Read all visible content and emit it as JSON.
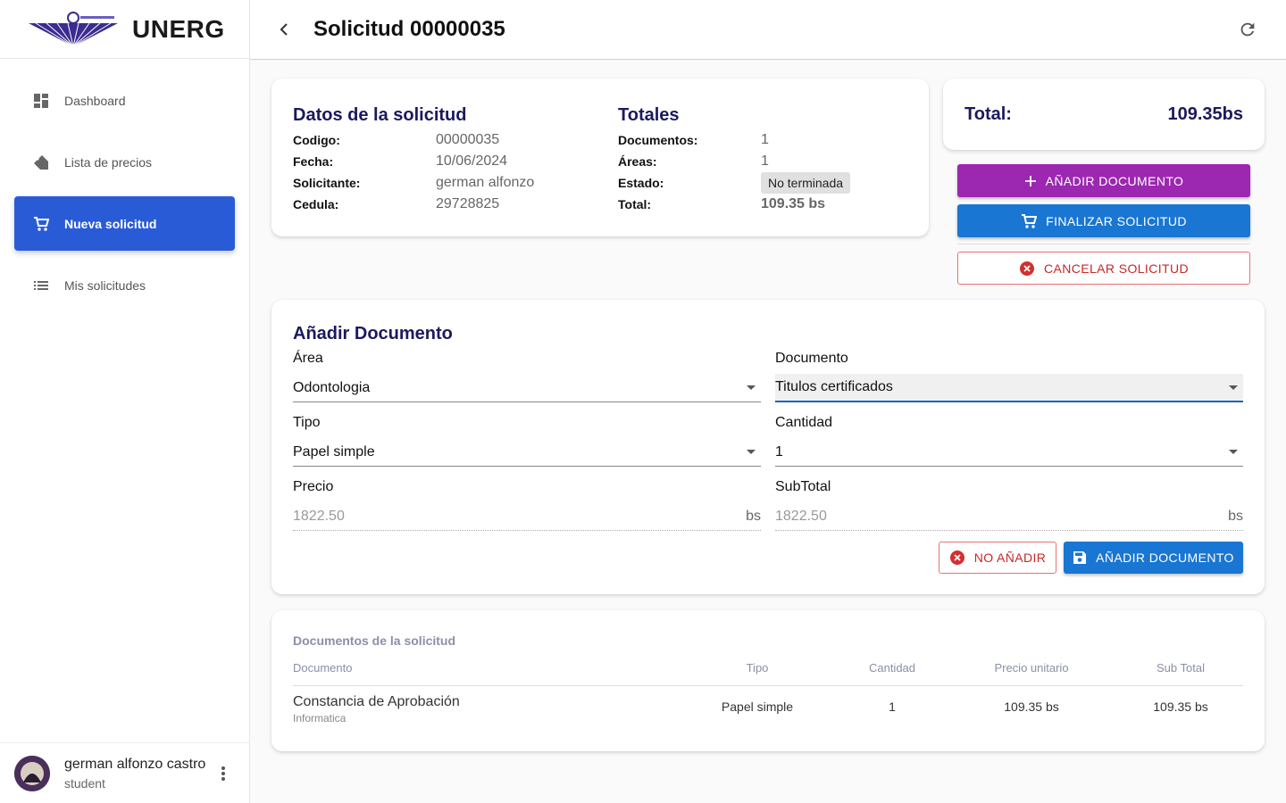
{
  "brand": {
    "name": "UNERG"
  },
  "sidebar": {
    "items": [
      {
        "label": "Dashboard",
        "icon": "dashboard-icon"
      },
      {
        "label": "Lista de precios",
        "icon": "tag-icon"
      },
      {
        "label": "Nueva solicitud",
        "icon": "cart-icon",
        "active": true
      },
      {
        "label": "Mis solicitudes",
        "icon": "list-icon"
      }
    ]
  },
  "user": {
    "name": "german alfonzo castro",
    "role": "student"
  },
  "header": {
    "title": "Solicitud 00000035"
  },
  "datos": {
    "title": "Datos de la solicitud",
    "rows": [
      {
        "label": "Codigo:",
        "value": "00000035"
      },
      {
        "label": "Fecha:",
        "value": "10/06/2024"
      },
      {
        "label": "Solicitante:",
        "value": "german alfonzo"
      },
      {
        "label": "Cedula:",
        "value": "29728825"
      }
    ]
  },
  "totales": {
    "title": "Totales",
    "rows": [
      {
        "label": "Documentos:",
        "value": "1"
      },
      {
        "label": "Áreas:",
        "value": "1"
      },
      {
        "label": "Estado:",
        "value": "No terminada"
      },
      {
        "label": "Total:",
        "value": "109.35 bs"
      }
    ]
  },
  "total_card": {
    "label": "Total:",
    "value": "109.35bs"
  },
  "actions": {
    "add_document": "AÑADIR DOCUMENTO",
    "finalize": "FINALIZAR SOLICITUD",
    "cancel": "CANCELAR SOLICITUD"
  },
  "add_form": {
    "title": "Añadir Documento",
    "area": {
      "label": "Área",
      "value": "Odontologia"
    },
    "documento": {
      "label": "Documento",
      "value": "Titulos certificados"
    },
    "tipo": {
      "label": "Tipo",
      "value": "Papel simple"
    },
    "cantidad": {
      "label": "Cantidad",
      "value": "1"
    },
    "precio": {
      "label": "Precio",
      "value": "1822.50",
      "unit": "bs"
    },
    "subtotal": {
      "label": "SubTotal",
      "value": "1822.50",
      "unit": "bs"
    },
    "no_add": "NO AÑADIR",
    "add": "AÑADIR DOCUMENTO"
  },
  "documents_table": {
    "title": "Documentos de la solicitud",
    "headers": [
      "Documento",
      "Tipo",
      "Cantidad",
      "Precio unitario",
      "Sub Total"
    ],
    "rows": [
      {
        "documento": "Constancia de Aprobación",
        "area": "Informatica",
        "tipo": "Papel simple",
        "cantidad": "1",
        "precio": "109.35 bs",
        "subtotal": "109.35 bs"
      }
    ]
  },
  "colors": {
    "active_nav": "#2a5bd7",
    "purple_button": "#9c27b0",
    "blue_button": "#1976d2",
    "danger": "#c62828",
    "title": "#1a1a5e"
  }
}
